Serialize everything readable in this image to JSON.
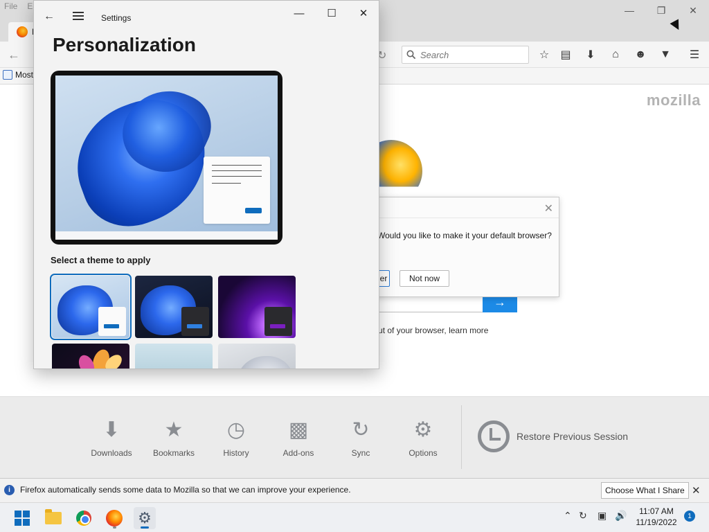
{
  "firefox": {
    "menu": [
      "File",
      "Ed"
    ],
    "tab_label": "F",
    "search_placeholder": "Search",
    "bookmark_label": "Most",
    "brand": "mozilla",
    "dialog": {
      "message": "Would you like to make it your default browser?",
      "primary_label": "Use Firefox as my default browser",
      "primary_visible": "er",
      "secondary_label": "Not now"
    },
    "learn_more": "ost out of your browser, learn more",
    "launcher": [
      {
        "label": "Downloads",
        "icon": "download-icon"
      },
      {
        "label": "Bookmarks",
        "icon": "star-icon"
      },
      {
        "label": "History",
        "icon": "clock-icon"
      },
      {
        "label": "Add-ons",
        "icon": "puzzle-icon"
      },
      {
        "label": "Sync",
        "icon": "sync-icon"
      },
      {
        "label": "Options",
        "icon": "gear-icon"
      }
    ],
    "restore_label": "Restore Previous Session",
    "infobar": {
      "text": "Firefox automatically sends some data to Mozilla so that we can improve your experience.",
      "button": "Choose What I Share"
    }
  },
  "settings": {
    "title": "Settings",
    "heading": "Personalization",
    "themes_label": "Select a theme to apply",
    "themes": [
      {
        "name": "light-bloom",
        "selected": true
      },
      {
        "name": "dark-bloom",
        "selected": false
      },
      {
        "name": "glow",
        "selected": false
      },
      {
        "name": "captured-motion",
        "selected": false
      },
      {
        "name": "sunrise",
        "selected": false
      },
      {
        "name": "flow",
        "selected": false
      }
    ]
  },
  "taskbar": {
    "apps": [
      "start",
      "file-explorer",
      "chrome",
      "firefox",
      "settings"
    ],
    "time": "11:07 AM",
    "date": "11/19/2022",
    "notification_count": "1"
  },
  "colors": {
    "accent": "#0f6cbd",
    "firefox_blue": "#1c8ae6"
  }
}
